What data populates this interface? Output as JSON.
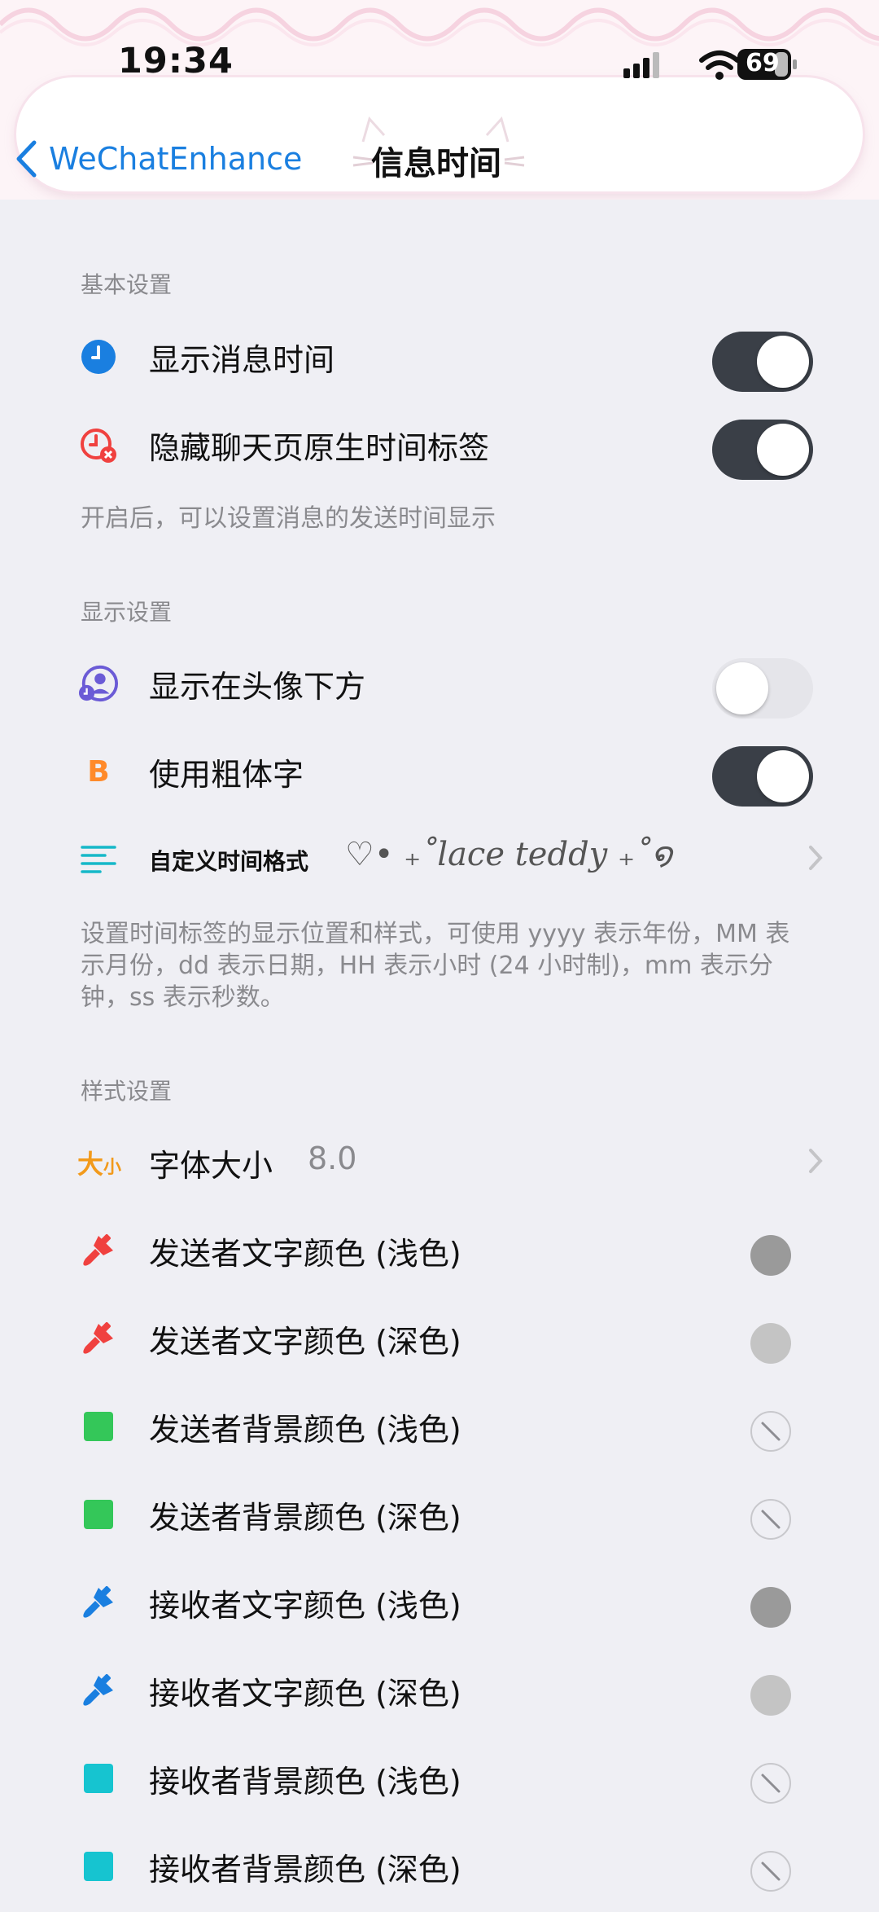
{
  "status": {
    "time": "19:34",
    "battery": "69"
  },
  "nav": {
    "back_label": "WeChatEnhance",
    "title": "信息时间"
  },
  "sections": {
    "basic": {
      "title": "基本设置",
      "items": [
        {
          "label": "显示消息时间",
          "on": true
        },
        {
          "label": "隐藏聊天页原生时间标签",
          "on": true
        }
      ],
      "note": "开启后，可以设置消息的发送时间显示"
    },
    "display": {
      "title": "显示设置",
      "items": [
        {
          "label": "显示在头像下方",
          "on": false
        },
        {
          "label": "使用粗体字",
          "on": true
        }
      ],
      "format": {
        "label": "自定义时间格式",
        "value": "♡• ₊˚lace teddy ₊˚໑"
      },
      "note": "设置时间标签的显示位置和样式，可使用 yyyy 表示年份，MM 表示月份，dd 表示日期，HH 表示小时 (24 小时制)，mm 表示分钟，ss 表示秒数。"
    },
    "style": {
      "title": "样式设置",
      "font_size": {
        "label": "字体大小",
        "value": "8.0",
        "icon_big": "大",
        "icon_small": "小"
      },
      "colors": [
        {
          "label": "发送者文字颜色 (浅色)",
          "icon": "brush-icon",
          "icon_color": "#f0413f",
          "swatch": "#9a9a9a"
        },
        {
          "label": "发送者文字颜色 (深色)",
          "icon": "brush-icon",
          "icon_color": "#f0413f",
          "swatch": "#c4c4c4"
        },
        {
          "label": "发送者背景颜色 (浅色)",
          "icon": "square-icon",
          "icon_color": "#34c759",
          "swatch": "none"
        },
        {
          "label": "发送者背景颜色 (深色)",
          "icon": "square-icon",
          "icon_color": "#34c759",
          "swatch": "none"
        },
        {
          "label": "接收者文字颜色 (浅色)",
          "icon": "brush-icon",
          "icon_color": "#1a7fe0",
          "swatch": "#9a9a9a"
        },
        {
          "label": "接收者文字颜色 (深色)",
          "icon": "brush-icon",
          "icon_color": "#1a7fe0",
          "swatch": "#c4c4c4"
        },
        {
          "label": "接收者背景颜色 (浅色)",
          "icon": "square-icon",
          "icon_color": "#16c4d0",
          "swatch": "none"
        },
        {
          "label": "接收者背景颜色 (深色)",
          "icon": "square-icon",
          "icon_color": "#16c4d0",
          "swatch": "none"
        }
      ]
    }
  },
  "colors": {
    "accent": "#1a7fe0",
    "toggle_on": "#3a3f47",
    "toggle_off": "#e5e5ea"
  }
}
